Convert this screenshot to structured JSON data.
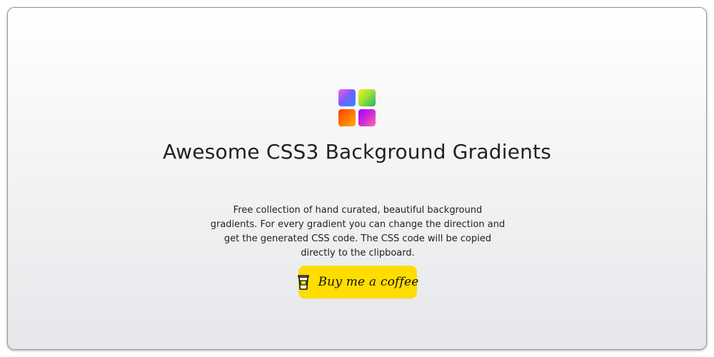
{
  "header": {
    "title": "Awesome CSS3 Background Gradients"
  },
  "description": {
    "text": "Free collection of hand curated, beautiful background gradients. For every gradient you can change the direction and get the generated CSS code. The CSS code will be copied directly to the clipboard."
  },
  "cta": {
    "label": "Buy me a coffee",
    "icon": "coffee-cup-icon"
  },
  "logo": {
    "icon": "gradient-grid-logo"
  },
  "colors": {
    "cta_bg": "#ffdd00",
    "text": "#222222",
    "page_bg_top": "#ffffff",
    "page_bg_bottom": "#e6e7ea"
  }
}
